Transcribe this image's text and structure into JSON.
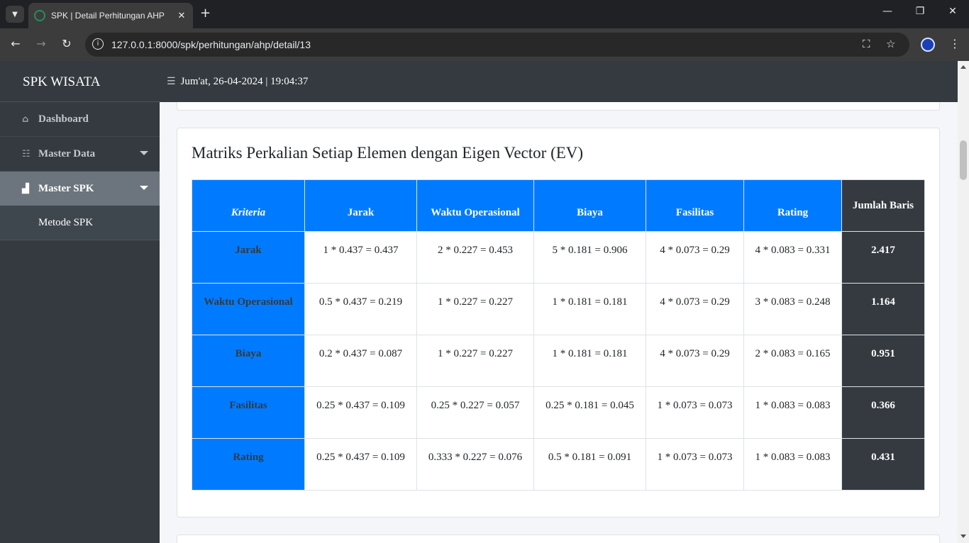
{
  "browser": {
    "tab_title": "SPK | Detail Perhitungan AHP",
    "url": "127.0.0.1:8000/spk/perhitungan/ahp/detail/13"
  },
  "sidebar": {
    "brand": "SPK WISATA",
    "items": [
      {
        "label": "Dashboard",
        "icon": "home-icon"
      },
      {
        "label": "Master Data",
        "icon": "cubes-icon"
      },
      {
        "label": "Master SPK",
        "icon": "sitemap-icon"
      }
    ],
    "sub_item": "Metode SPK"
  },
  "topbar": {
    "datetime": "Jum'at, 26-04-2024 | 19:04:37"
  },
  "card": {
    "title": "Matriks Perkalian Setiap Elemen dengan Eigen Vector (EV)"
  },
  "table": {
    "headers": [
      "Kriteria",
      "Jarak",
      "Waktu Operasional",
      "Biaya",
      "Fasilitas",
      "Rating",
      "Jumlah Baris"
    ],
    "rows": [
      {
        "name": "Jarak",
        "cells": [
          "1 * 0.437 = 0.437",
          "2 * 0.227 = 0.453",
          "5 * 0.181 = 0.906",
          "4 * 0.073 = 0.29",
          "4 * 0.083 = 0.331"
        ],
        "total": "2.417"
      },
      {
        "name": "Waktu Operasional",
        "cells": [
          "0.5 * 0.437 = 0.219",
          "1 * 0.227 = 0.227",
          "1 * 0.181 = 0.181",
          "4 * 0.073 = 0.29",
          "3 * 0.083 = 0.248"
        ],
        "total": "1.164"
      },
      {
        "name": "Biaya",
        "cells": [
          "0.2 * 0.437 = 0.087",
          "1 * 0.227 = 0.227",
          "1 * 0.181 = 0.181",
          "4 * 0.073 = 0.29",
          "2 * 0.083 = 0.165"
        ],
        "total": "0.951"
      },
      {
        "name": "Fasilitas",
        "cells": [
          "0.25 * 0.437 = 0.109",
          "0.25 * 0.227 = 0.057",
          "0.25 * 0.181 = 0.045",
          "1 * 0.073 = 0.073",
          "1 * 0.083 = 0.083"
        ],
        "total": "0.366"
      },
      {
        "name": "Rating",
        "cells": [
          "0.25 * 0.437 = 0.109",
          "0.333 * 0.227 = 0.076",
          "0.5 * 0.181 = 0.091",
          "1 * 0.073 = 0.073",
          "1 * 0.083 = 0.083"
        ],
        "total": "0.431"
      }
    ]
  }
}
